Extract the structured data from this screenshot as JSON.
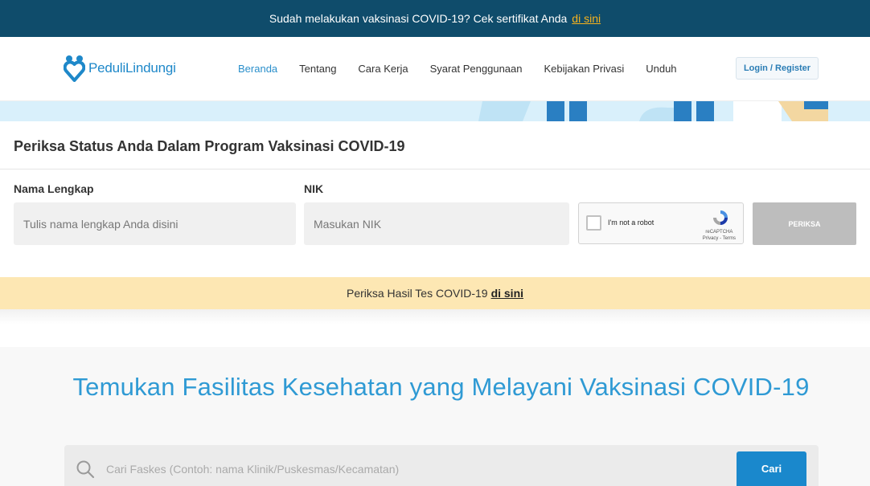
{
  "topbar": {
    "message": "Sudah melakukan vaksinasi COVID-19? Cek sertifikat Anda",
    "link": "di sini"
  },
  "nav": {
    "logo_text": "PeduliLindungi",
    "links": [
      "Beranda",
      "Tentang",
      "Cara Kerja",
      "Syarat Penggunaan",
      "Kebijakan Privasi",
      "Unduh"
    ],
    "login": "Login / Register"
  },
  "check": {
    "title": "Periksa Status Anda Dalam Program Vaksinasi COVID-19",
    "name_label": "Nama Lengkap",
    "name_placeholder": "Tulis nama lengkap Anda disini",
    "nik_label": "NIK",
    "nik_placeholder": "Masukan NIK",
    "captcha_text": "I'm not a robot",
    "captcha_brand": "reCAPTCHA",
    "captcha_links": "Privacy - Terms",
    "button": "PERIKSA"
  },
  "notice": {
    "text": "Periksa Hasil Tes COVID-19",
    "link": "di sini"
  },
  "fasilitas": {
    "title": "Temukan Fasilitas Kesehatan yang Melayani Vaksinasi COVID-19",
    "search_placeholder": "Cari Faskes (Contoh: nama Klinik/Puskesmas/Kecamatan)",
    "button": "Cari"
  },
  "colors": {
    "topbar_bg": "#0f4c6b",
    "brand_blue": "#1e88c9",
    "link_gold": "#f7b21c",
    "notice_bg": "#fde7b3",
    "button_disabled": "#bdbdbd",
    "cari_bg": "#1a88cc"
  }
}
